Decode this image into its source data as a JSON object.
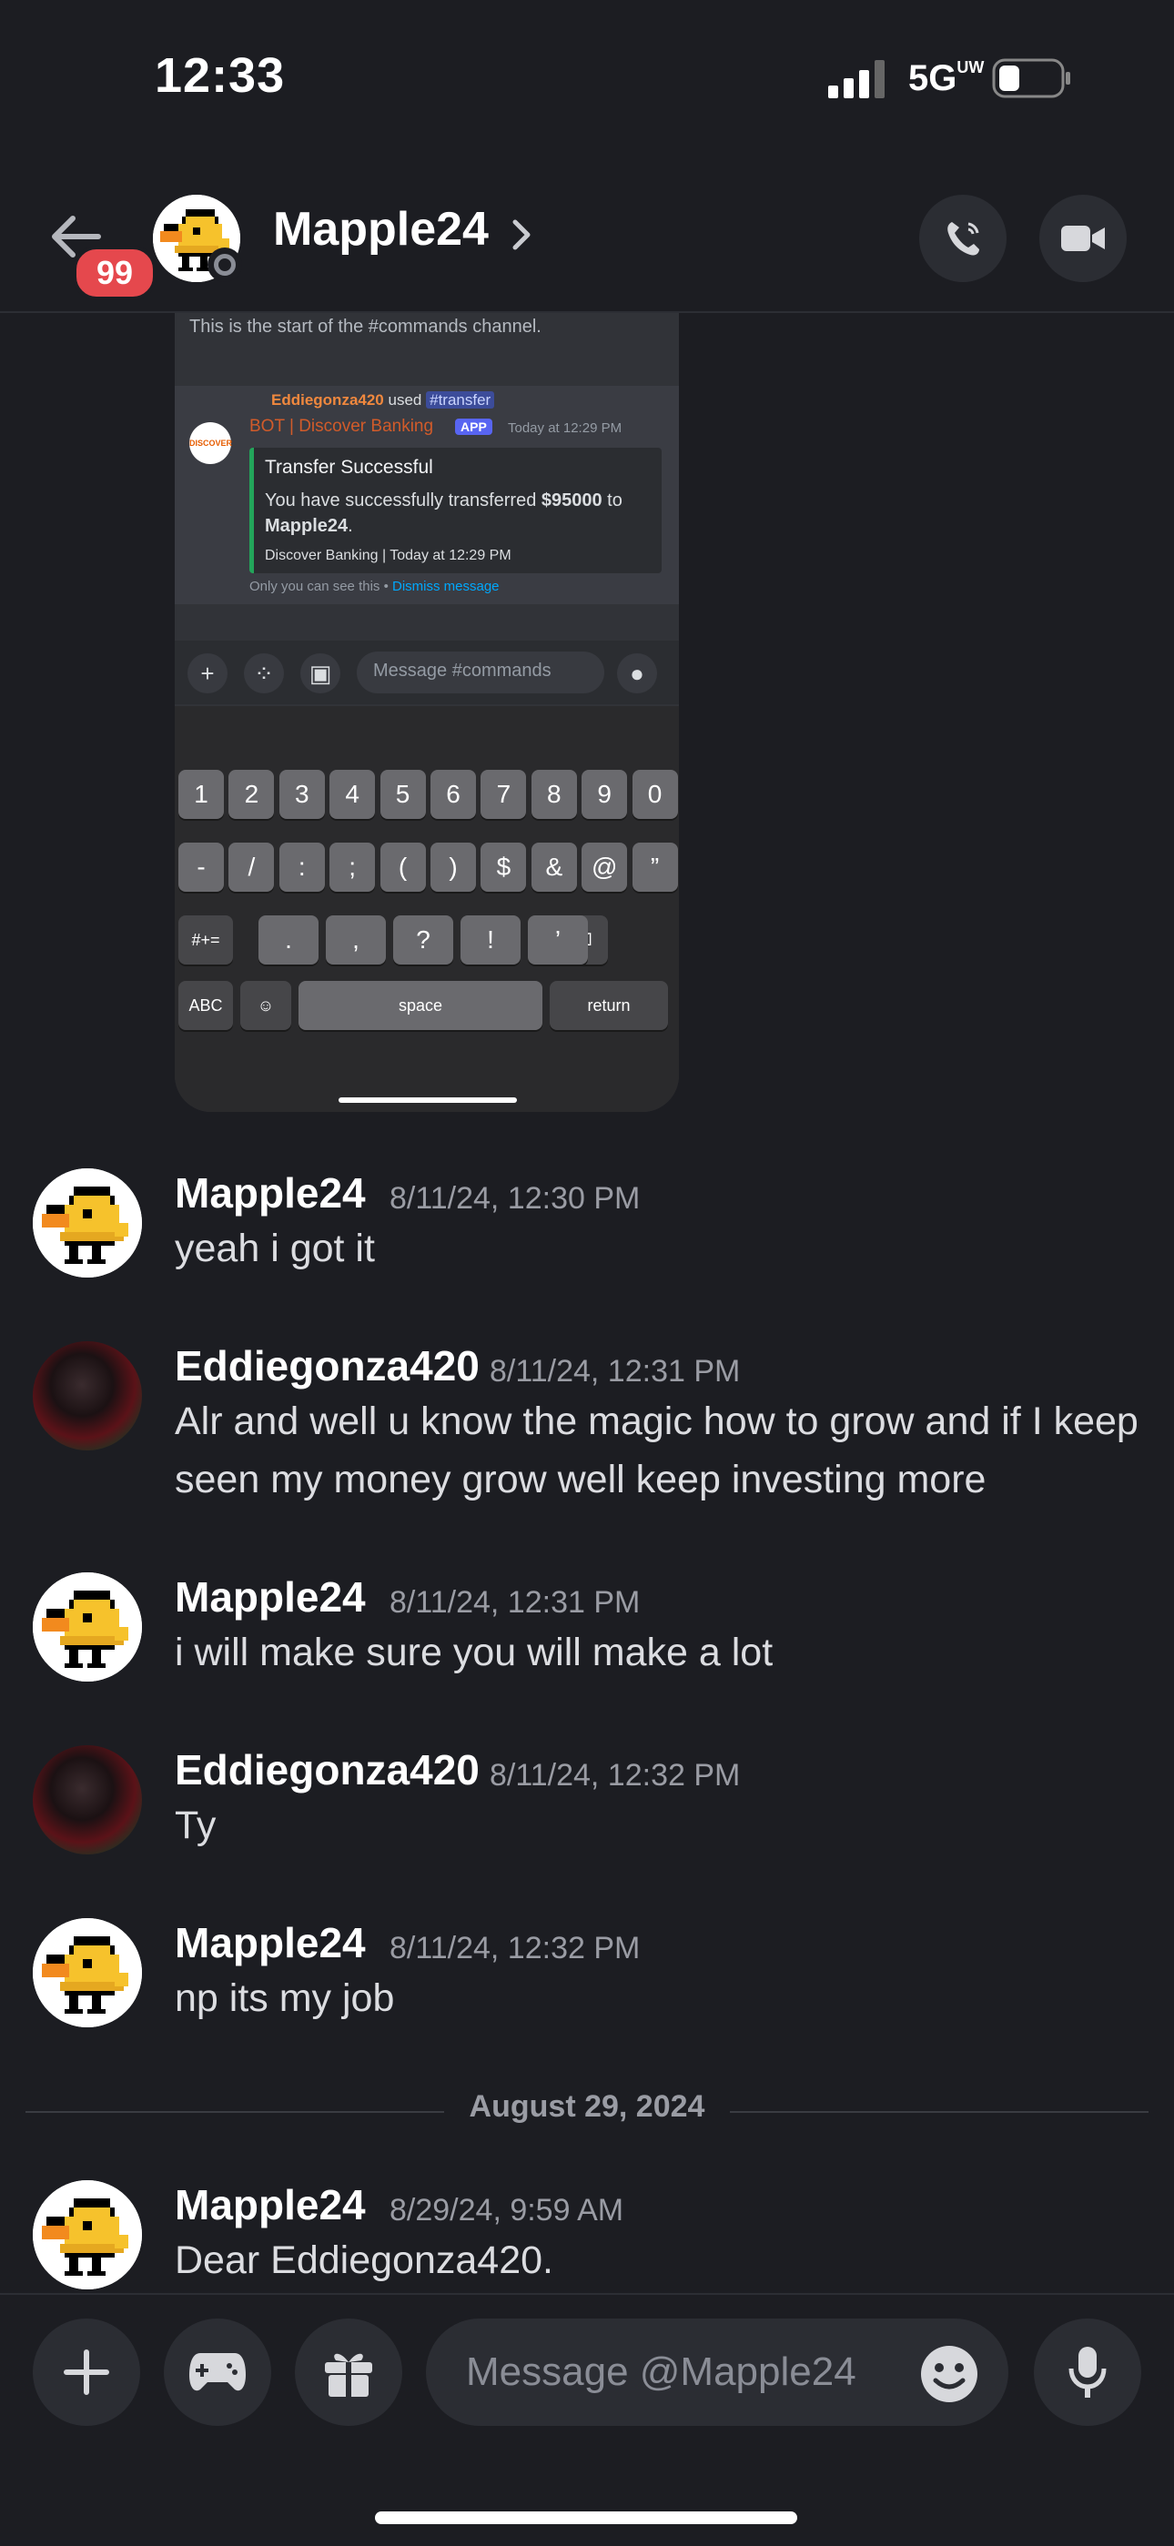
{
  "status_bar": {
    "time": "12:33",
    "network": "5G",
    "network_suffix": "UW"
  },
  "header": {
    "badge": "99",
    "name": "Mapple24"
  },
  "embedded": {
    "start_text": "This is the start of the #commands channel.",
    "user": "Eddiegonza420",
    "used": "used",
    "command": "#transfer",
    "bot": "BOT | Discover Banking",
    "app_tag": "APP",
    "timestamp": "Today at 12:29 PM",
    "logo_text": "DISCOVER",
    "embed_title": "Transfer Successful",
    "embed_desc_prefix": "You have successfully transferred ",
    "embed_amount": "$95000",
    "embed_to": " to ",
    "embed_recipient": "Mapple24",
    "embed_footer": "Discover Banking | Today at 12:29 PM",
    "only_you": "Only you can see this • ",
    "dismiss": "Dismiss message",
    "input_placeholder": "Message #commands",
    "keys_row1": [
      "1",
      "2",
      "3",
      "4",
      "5",
      "6",
      "7",
      "8",
      "9",
      "0"
    ],
    "keys_row2": [
      "-",
      "/",
      ":",
      ";",
      "(",
      ")",
      "$",
      "&",
      "@",
      "”"
    ],
    "keys_row3": [
      ".",
      ",",
      "?",
      "!",
      "’"
    ],
    "key_symbols": "#+=",
    "key_abc": "ABC",
    "key_space": "space",
    "key_return": "return"
  },
  "messages": [
    {
      "author": "Mapple24",
      "time": "8/11/24, 12:30 PM",
      "text": "yeah i got it"
    },
    {
      "author": "Eddiegonza420",
      "time": "8/11/24, 12:31 PM",
      "text": "Alr and well u know the magic how to grow and if I keep seen my money grow well keep investing more"
    },
    {
      "author": "Mapple24",
      "time": "8/11/24, 12:31 PM",
      "text": "i will make sure you will make a lot"
    },
    {
      "author": "Eddiegonza420",
      "time": "8/11/24, 12:32 PM",
      "text": "Ty"
    },
    {
      "author": "Mapple24",
      "time": "8/11/24, 12:32 PM",
      "text": "np its my job"
    },
    {
      "author": "Mapple24",
      "time": "8/29/24, 9:59 AM",
      "text": "Dear Eddiegonza420."
    }
  ],
  "date_divider": "August 29, 2024",
  "composer": {
    "placeholder": "Message @Mapple24"
  },
  "colors": {
    "background": "#1c1d22",
    "accent": "#5865f2",
    "badge": "#e5484d"
  }
}
